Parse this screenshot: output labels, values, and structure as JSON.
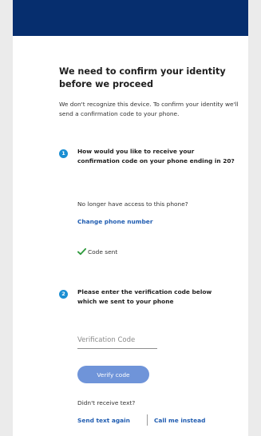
{
  "heading": "We need to confirm your identity before we proceed",
  "intro": "We don't recognize this device. To confirm your identity we'll send a confirmation code to your phone.",
  "step1": {
    "number": "1",
    "question": "How would you like to receive your confirmation code on your phone ending in 20?",
    "no_access": "No longer have access to this phone?",
    "change_link": "Change phone number",
    "code_sent": "Code sent"
  },
  "step2": {
    "number": "2",
    "instruction": "Please enter the verification code below which we sent to your phone",
    "input_placeholder": "Verification Code",
    "verify_button": "Verify code"
  },
  "footer": {
    "didnt_receive": "Didn't receive text?",
    "send_again": "Send text again",
    "call_me": "Call me instead"
  },
  "colors": {
    "header": "#062e6e",
    "badge": "#1b8fd3",
    "link": "#1e5bb0",
    "button": "#6f94d9",
    "check": "#2e9a3c"
  }
}
